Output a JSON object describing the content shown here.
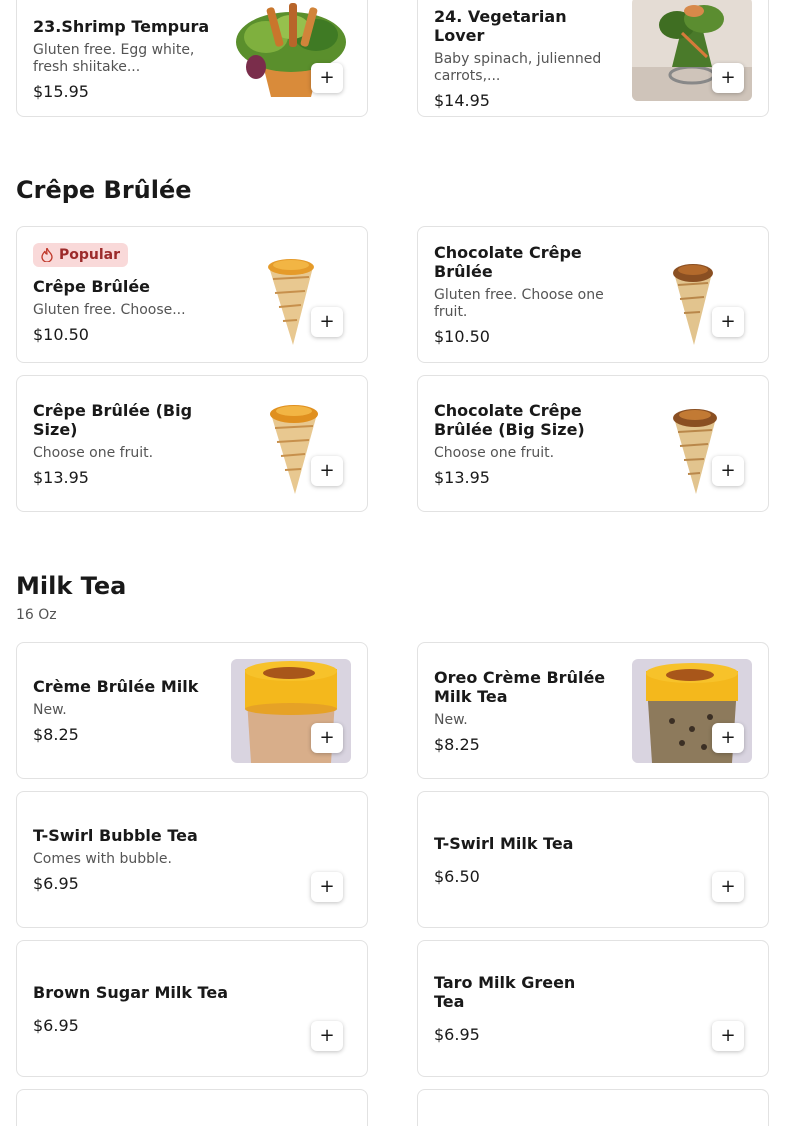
{
  "sections": [
    {
      "items": [
        {
          "name": "23.Shrimp Tempura",
          "desc": "Gluten free. Egg white, fresh shiitake...",
          "price": "$15.95"
        },
        {
          "name": "24. Vegetarian Lover",
          "desc": "Baby spinach, julienned carrots,...",
          "price": "$14.95"
        }
      ]
    },
    {
      "title": "Crêpe Brûlée",
      "items": [
        {
          "badge": "Popular",
          "badge_icon": "fire-icon",
          "name": "Crêpe Brûlée",
          "desc": "Gluten free. Choose...",
          "price": "$10.50"
        },
        {
          "name": "Chocolate Crêpe Brûlée",
          "desc": "Gluten free. Choose one fruit.",
          "price": "$10.50"
        },
        {
          "name": "Crêpe Brûlée (Big Size)",
          "desc": "Choose one fruit.",
          "price": "$13.95"
        },
        {
          "name": "Chocolate Crêpe Brûlée (Big Size)",
          "desc": "Choose one fruit.",
          "price": "$13.95"
        }
      ]
    },
    {
      "title": "Milk Tea",
      "subtitle": "16 Oz",
      "items": [
        {
          "name": "Crème Brûlée Milk",
          "desc": "New.",
          "price": "$8.25"
        },
        {
          "name": "Oreo Crème Brûlée Milk Tea",
          "desc": "New.",
          "price": "$8.25"
        },
        {
          "name": "T-Swirl Bubble Tea",
          "desc": "Comes with bubble.",
          "price": "$6.95"
        },
        {
          "name": "T-Swirl Milk Tea",
          "price": "$6.50"
        },
        {
          "name": "Brown Sugar Milk Tea",
          "price": "$6.95"
        },
        {
          "name": "Taro Milk Green Tea",
          "price": "$6.95"
        }
      ]
    }
  ],
  "add_label": "+",
  "colors": {
    "badge_bg": "#f9d9d9",
    "badge_text": "#9c2b2b",
    "border": "#e2e2e2"
  }
}
